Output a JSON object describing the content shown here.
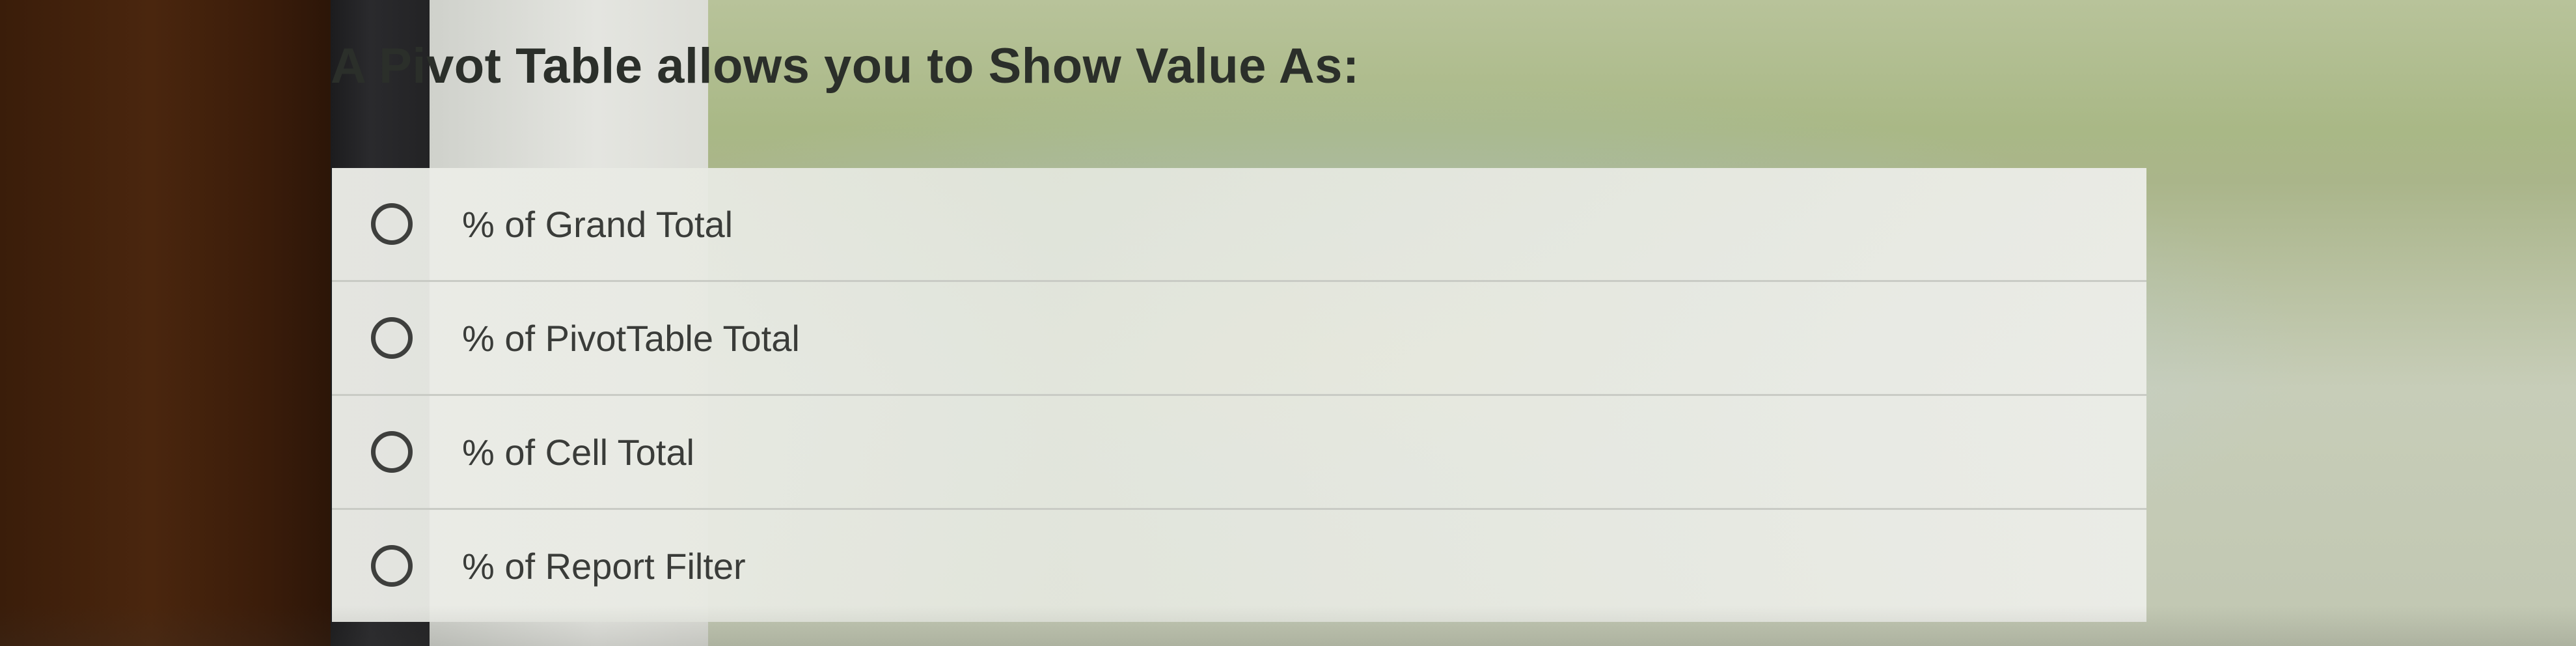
{
  "question": {
    "text": "A Pivot Table allows you to Show Value As:"
  },
  "options": [
    {
      "label": "% of Grand Total",
      "selected": false
    },
    {
      "label": "% of PivotTable Total",
      "selected": false
    },
    {
      "label": "% of Cell Total",
      "selected": false
    },
    {
      "label": "% of Report Filter",
      "selected": false
    }
  ]
}
